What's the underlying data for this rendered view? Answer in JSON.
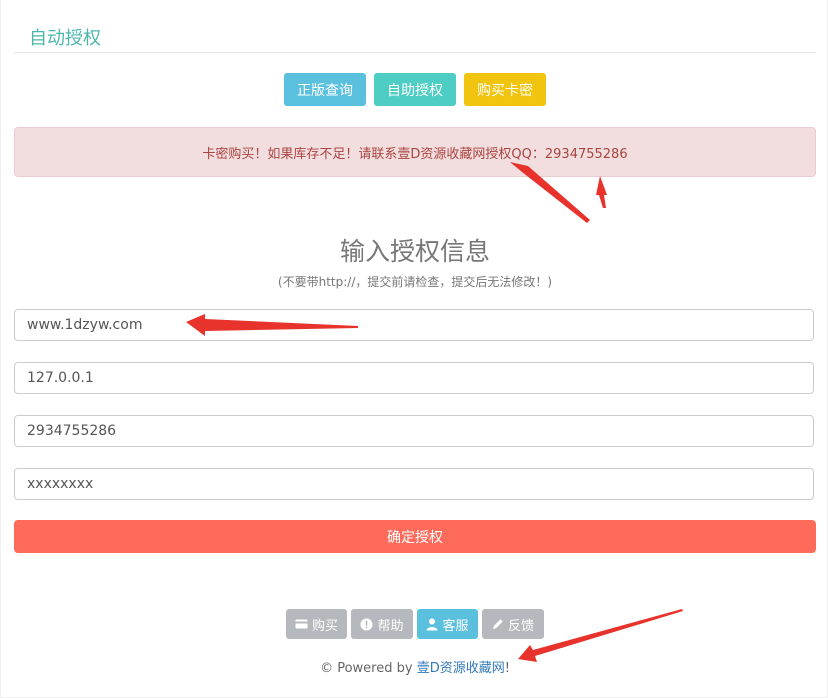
{
  "panel": {
    "title": "自动授权"
  },
  "top_buttons": {
    "query": "正版查询",
    "self_auth": "自助授权",
    "buy_card": "购买卡密"
  },
  "alert": {
    "text": "卡密购买！如果库存不足！请联系壹D资源收藏网授权QQ：2934755286"
  },
  "form": {
    "heading": "输入授权信息",
    "subheading": "(不要带http://，提交前请检查，提交后无法修改！)",
    "domain_value": "www.1dzyw.com",
    "ip_value": "127.0.0.1",
    "qq_value": "2934755286",
    "code_value": "xxxxxxxx",
    "submit_label": "确定授权"
  },
  "footer_buttons": {
    "buy": "购买",
    "help": "帮助",
    "service": "客服",
    "feedback": "反馈"
  },
  "powered": {
    "prefix": "© Powered by ",
    "brand": "壹D资源收藏网",
    "suffix": "!"
  },
  "colors": {
    "title": "#4db6ac",
    "query_button": "#5bc0de",
    "auth_button": "#4ecdc4",
    "buy_button": "#f1c40f",
    "alert_bg": "#f2dede",
    "alert_text": "#a94442",
    "submit_button": "#ff6b5b",
    "footer_gray": "#b5b9bd",
    "annotation_arrow": "#e8322c"
  },
  "icons": {
    "buy": "card-icon",
    "help": "exclamation-circle-icon",
    "service": "user-icon",
    "feedback": "pencil-icon"
  }
}
